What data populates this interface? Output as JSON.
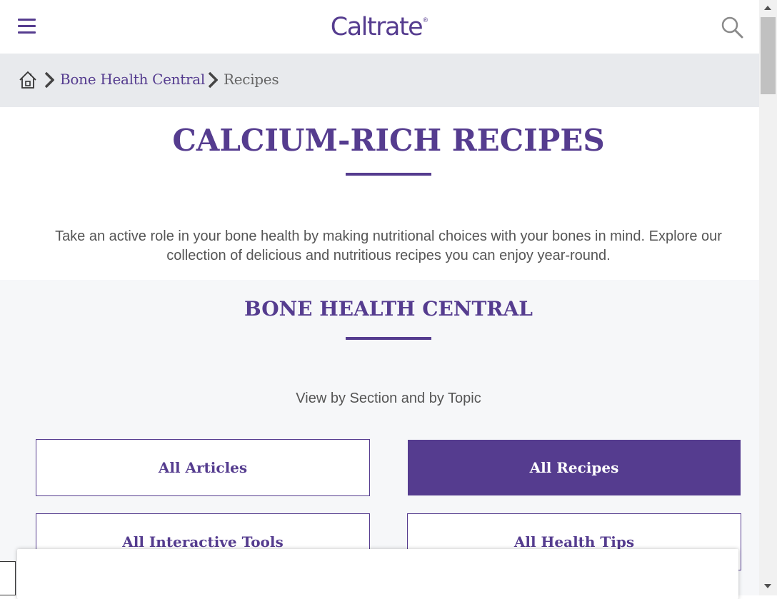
{
  "header": {
    "menu_icon": "hamburger-menu-icon",
    "logo_text": "Caltrate",
    "logo_mark": "®",
    "search_icon": "search-icon"
  },
  "breadcrumb": {
    "home_icon": "home-icon",
    "items": [
      {
        "label": "Bone Health Central"
      },
      {
        "label": "Recipes"
      }
    ]
  },
  "main": {
    "title": "CALCIUM-RICH RECIPES",
    "intro": "Take an active role in your bone health by making nutritional choices with your bones in mind. Explore our collection of delicious and nutritious recipes you can enjoy year-round."
  },
  "bone_health_central": {
    "title": "BONE HEALTH CENTRAL",
    "subtitle": "View by Section and by Topic",
    "buttons": [
      {
        "label": "All Articles"
      },
      {
        "label": "All Recipes",
        "active": true
      },
      {
        "label": "All Interactive Tools"
      },
      {
        "label": "All Health Tips"
      }
    ]
  },
  "colors": {
    "brand_purple": "#553c8f",
    "breadcrumb_bg": "#e8eaed",
    "section_bg": "#f6f7f9"
  }
}
